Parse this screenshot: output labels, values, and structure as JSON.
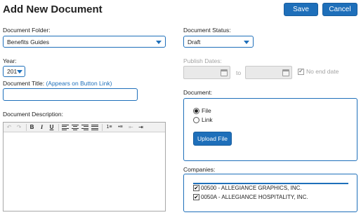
{
  "page": {
    "title": "Add New Document"
  },
  "actions": {
    "save_label": "Save",
    "cancel_label": "Cancel"
  },
  "folder": {
    "label": "Document Folder:",
    "value": "Benefits Guides"
  },
  "status": {
    "label": "Document Status:",
    "value": "Draft"
  },
  "year": {
    "label": "Year:",
    "value": "201"
  },
  "publish": {
    "label": "Publish Dates:",
    "to_label": "to",
    "no_end_label": "No end date",
    "no_end_checked": true
  },
  "doc_title": {
    "label": "Document Title:",
    "hint": "(Appears on Button Link)",
    "value": ""
  },
  "document": {
    "label": "Document:",
    "options": [
      "File",
      "Link"
    ],
    "selected": "File",
    "upload_label": "Upload File"
  },
  "description": {
    "label": "Document Description:",
    "toolbar": {
      "undo": "↶",
      "redo": "↷",
      "bold": "B",
      "italic": "I",
      "underline": "U",
      "ordered_list": "1≡",
      "unordered_list": "•≡",
      "outdent": "⇤",
      "indent": "⇥"
    }
  },
  "companies": {
    "label": "Companies:",
    "items": [
      {
        "label": "00500 - ALLEGIANCE GRAPHICS, INC.",
        "checked": true
      },
      {
        "label": "0050A - ALLEGIANCE HOSPITALITY, INC.",
        "checked": true
      }
    ]
  },
  "colors": {
    "accent": "#1e6fba",
    "disabled_bg": "#e9e9e9"
  }
}
